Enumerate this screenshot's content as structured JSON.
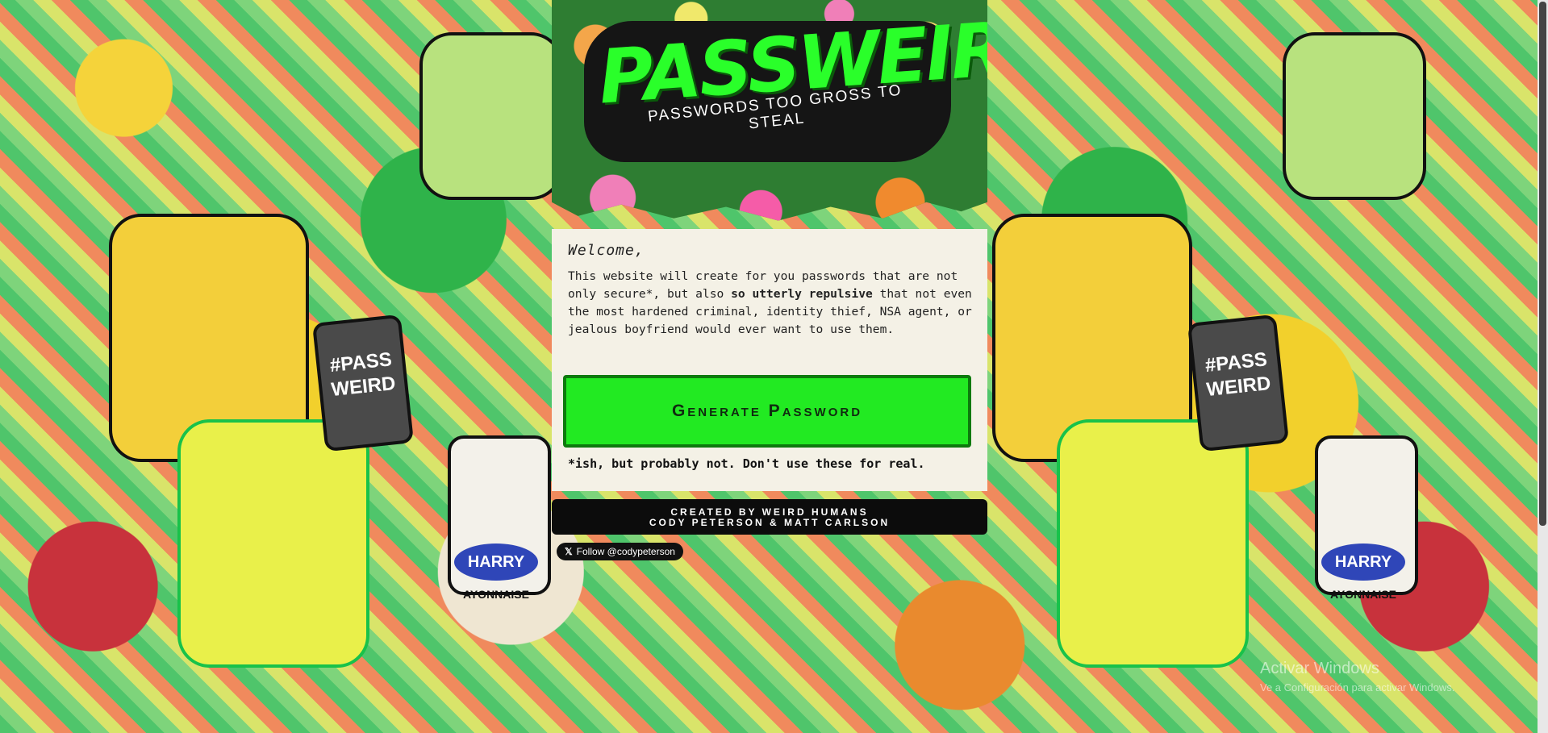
{
  "background": {
    "badge_text_left": "#PASS WEIRD",
    "badge_text_right": "#PASS WEIRD",
    "jar_label": "HARRY",
    "jar_sublabel": "AYONNAISE"
  },
  "header": {
    "logo": "PASSWEIRD",
    "tagline": "PASSWORDS TOO GROSS TO STEAL"
  },
  "card": {
    "welcome": "Welcome,",
    "intro_before": "This website will create for you passwords that are not only secure*, but also ",
    "intro_bold": "so utterly repulsive",
    "intro_after": " that not even the most hardened criminal, identity thief, NSA agent, or jealous boyfriend would ever want to use them.",
    "generate_button": "Generate Password",
    "footnote": "*ish, but probably not. Don't use these for real."
  },
  "credits": {
    "line1": "CREATED BY WEIRD HUMANS",
    "line2": "CODY PETERSON & MATT CARLSON"
  },
  "follow_button": {
    "icon": "x-logo-icon",
    "label": "Follow @codypeterson"
  },
  "os_watermark": {
    "title": "Activar Windows",
    "subtitle": "Ve a Configuración para activar Windows."
  }
}
